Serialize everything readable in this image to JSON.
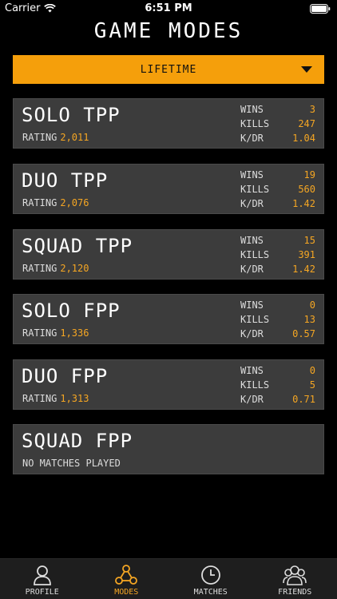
{
  "status": {
    "carrier": "Carrier",
    "time": "6:51 PM"
  },
  "title": "GAME MODES",
  "filter": {
    "selected": "LIFETIME"
  },
  "labels": {
    "rating": "RATING",
    "wins": "WINS",
    "kills": "KILLS",
    "kdr": "K/DR"
  },
  "modes": [
    {
      "name": "SOLO TPP",
      "rating": "2,011",
      "wins": "3",
      "kills": "247",
      "kdr": "1.04"
    },
    {
      "name": "DUO TPP",
      "rating": "2,076",
      "wins": "19",
      "kills": "560",
      "kdr": "1.42"
    },
    {
      "name": "SQUAD TPP",
      "rating": "2,120",
      "wins": "15",
      "kills": "391",
      "kdr": "1.42"
    },
    {
      "name": "SOLO FPP",
      "rating": "1,336",
      "wins": "0",
      "kills": "13",
      "kdr": "0.57"
    },
    {
      "name": "DUO FPP",
      "rating": "1,313",
      "wins": "0",
      "kills": "5",
      "kdr": "0.71"
    },
    {
      "name": "SQUAD FPP",
      "no_matches": "NO MATCHES PLAYED"
    }
  ],
  "tabs": [
    {
      "label": "PROFILE",
      "icon": "person-icon"
    },
    {
      "label": "MODES",
      "icon": "nodes-icon"
    },
    {
      "label": "MATCHES",
      "icon": "clock-icon"
    },
    {
      "label": "FRIENDS",
      "icon": "group-icon"
    }
  ],
  "colors": {
    "accent": "#f5a623",
    "dropdown": "#f59f0b",
    "card": "#3c3c3c",
    "tabbar": "#1e1e1e"
  }
}
